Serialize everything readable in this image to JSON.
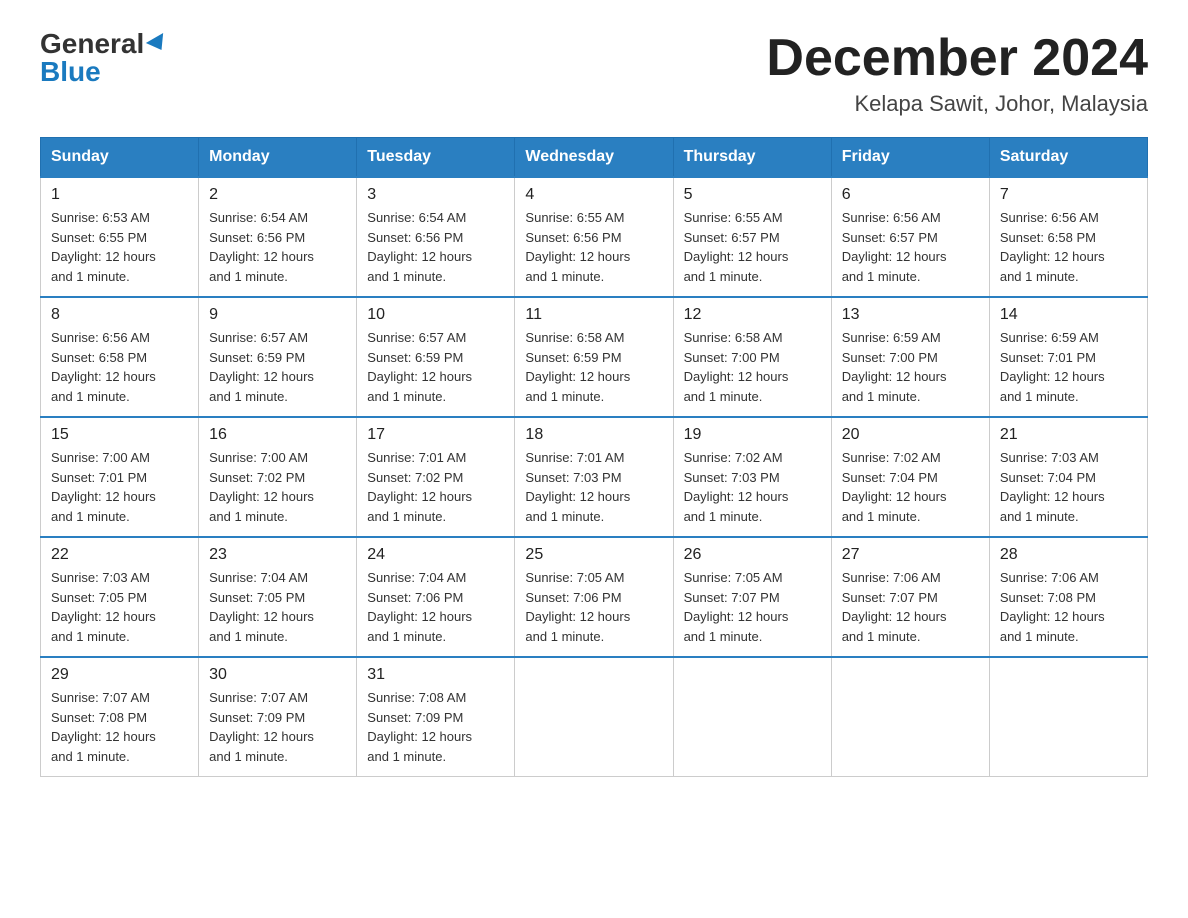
{
  "header": {
    "logo_general": "General",
    "logo_blue": "Blue",
    "month_title": "December 2024",
    "location": "Kelapa Sawit, Johor, Malaysia"
  },
  "weekdays": [
    "Sunday",
    "Monday",
    "Tuesday",
    "Wednesday",
    "Thursday",
    "Friday",
    "Saturday"
  ],
  "weeks": [
    [
      {
        "day": "1",
        "sunrise": "6:53 AM",
        "sunset": "6:55 PM",
        "daylight": "12 hours and 1 minute."
      },
      {
        "day": "2",
        "sunrise": "6:54 AM",
        "sunset": "6:56 PM",
        "daylight": "12 hours and 1 minute."
      },
      {
        "day": "3",
        "sunrise": "6:54 AM",
        "sunset": "6:56 PM",
        "daylight": "12 hours and 1 minute."
      },
      {
        "day": "4",
        "sunrise": "6:55 AM",
        "sunset": "6:56 PM",
        "daylight": "12 hours and 1 minute."
      },
      {
        "day": "5",
        "sunrise": "6:55 AM",
        "sunset": "6:57 PM",
        "daylight": "12 hours and 1 minute."
      },
      {
        "day": "6",
        "sunrise": "6:56 AM",
        "sunset": "6:57 PM",
        "daylight": "12 hours and 1 minute."
      },
      {
        "day": "7",
        "sunrise": "6:56 AM",
        "sunset": "6:58 PM",
        "daylight": "12 hours and 1 minute."
      }
    ],
    [
      {
        "day": "8",
        "sunrise": "6:56 AM",
        "sunset": "6:58 PM",
        "daylight": "12 hours and 1 minute."
      },
      {
        "day": "9",
        "sunrise": "6:57 AM",
        "sunset": "6:59 PM",
        "daylight": "12 hours and 1 minute."
      },
      {
        "day": "10",
        "sunrise": "6:57 AM",
        "sunset": "6:59 PM",
        "daylight": "12 hours and 1 minute."
      },
      {
        "day": "11",
        "sunrise": "6:58 AM",
        "sunset": "6:59 PM",
        "daylight": "12 hours and 1 minute."
      },
      {
        "day": "12",
        "sunrise": "6:58 AM",
        "sunset": "7:00 PM",
        "daylight": "12 hours and 1 minute."
      },
      {
        "day": "13",
        "sunrise": "6:59 AM",
        "sunset": "7:00 PM",
        "daylight": "12 hours and 1 minute."
      },
      {
        "day": "14",
        "sunrise": "6:59 AM",
        "sunset": "7:01 PM",
        "daylight": "12 hours and 1 minute."
      }
    ],
    [
      {
        "day": "15",
        "sunrise": "7:00 AM",
        "sunset": "7:01 PM",
        "daylight": "12 hours and 1 minute."
      },
      {
        "day": "16",
        "sunrise": "7:00 AM",
        "sunset": "7:02 PM",
        "daylight": "12 hours and 1 minute."
      },
      {
        "day": "17",
        "sunrise": "7:01 AM",
        "sunset": "7:02 PM",
        "daylight": "12 hours and 1 minute."
      },
      {
        "day": "18",
        "sunrise": "7:01 AM",
        "sunset": "7:03 PM",
        "daylight": "12 hours and 1 minute."
      },
      {
        "day": "19",
        "sunrise": "7:02 AM",
        "sunset": "7:03 PM",
        "daylight": "12 hours and 1 minute."
      },
      {
        "day": "20",
        "sunrise": "7:02 AM",
        "sunset": "7:04 PM",
        "daylight": "12 hours and 1 minute."
      },
      {
        "day": "21",
        "sunrise": "7:03 AM",
        "sunset": "7:04 PM",
        "daylight": "12 hours and 1 minute."
      }
    ],
    [
      {
        "day": "22",
        "sunrise": "7:03 AM",
        "sunset": "7:05 PM",
        "daylight": "12 hours and 1 minute."
      },
      {
        "day": "23",
        "sunrise": "7:04 AM",
        "sunset": "7:05 PM",
        "daylight": "12 hours and 1 minute."
      },
      {
        "day": "24",
        "sunrise": "7:04 AM",
        "sunset": "7:06 PM",
        "daylight": "12 hours and 1 minute."
      },
      {
        "day": "25",
        "sunrise": "7:05 AM",
        "sunset": "7:06 PM",
        "daylight": "12 hours and 1 minute."
      },
      {
        "day": "26",
        "sunrise": "7:05 AM",
        "sunset": "7:07 PM",
        "daylight": "12 hours and 1 minute."
      },
      {
        "day": "27",
        "sunrise": "7:06 AM",
        "sunset": "7:07 PM",
        "daylight": "12 hours and 1 minute."
      },
      {
        "day": "28",
        "sunrise": "7:06 AM",
        "sunset": "7:08 PM",
        "daylight": "12 hours and 1 minute."
      }
    ],
    [
      {
        "day": "29",
        "sunrise": "7:07 AM",
        "sunset": "7:08 PM",
        "daylight": "12 hours and 1 minute."
      },
      {
        "day": "30",
        "sunrise": "7:07 AM",
        "sunset": "7:09 PM",
        "daylight": "12 hours and 1 minute."
      },
      {
        "day": "31",
        "sunrise": "7:08 AM",
        "sunset": "7:09 PM",
        "daylight": "12 hours and 1 minute."
      },
      null,
      null,
      null,
      null
    ]
  ],
  "labels": {
    "sunrise_prefix": "Sunrise: ",
    "sunset_prefix": "Sunset: ",
    "daylight_prefix": "Daylight: "
  }
}
